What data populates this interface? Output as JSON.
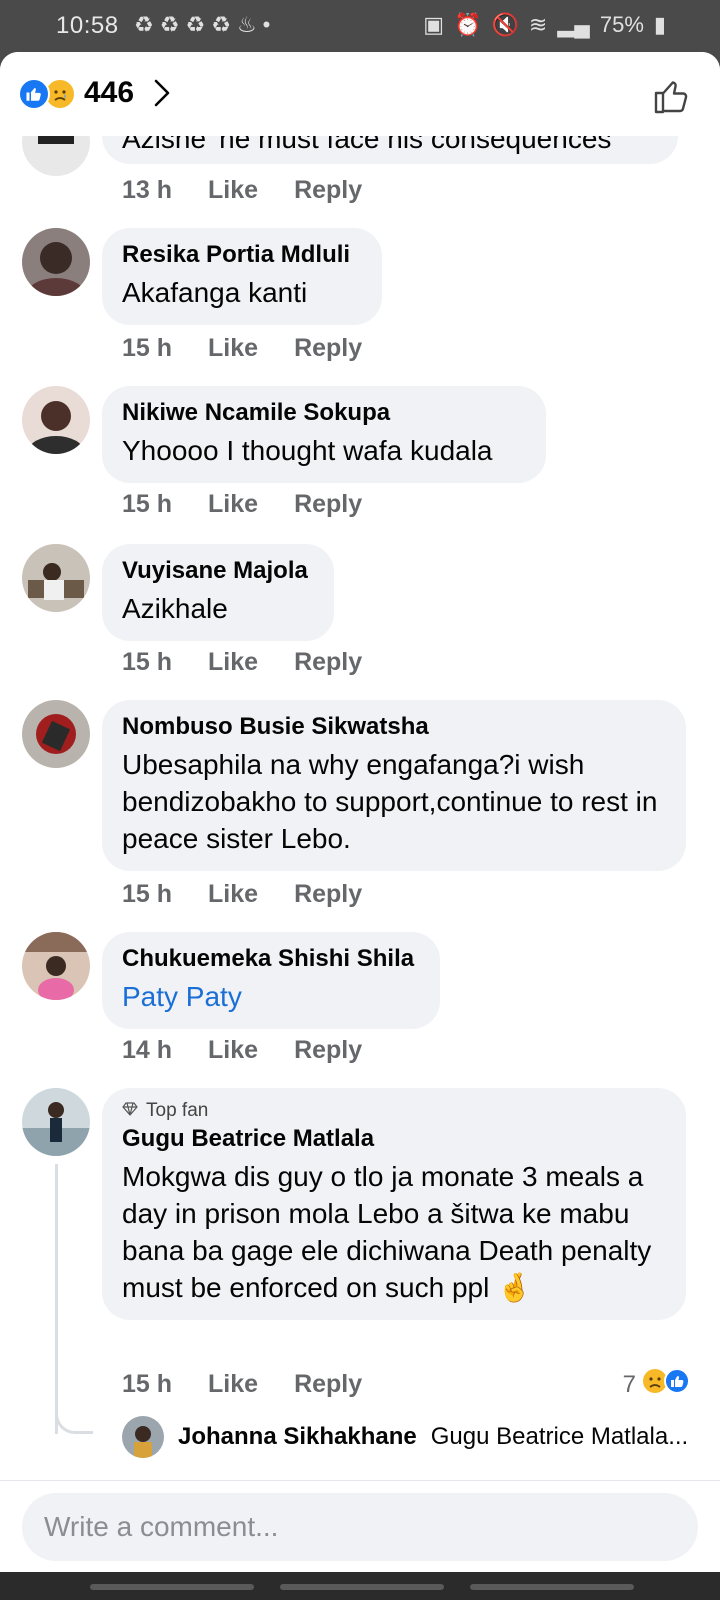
{
  "status_bar": {
    "time": "10:58",
    "battery": "75%"
  },
  "header": {
    "reaction_count": "446"
  },
  "comments": [
    {
      "author": "",
      "text": "Azishe' he must face his  consequences",
      "time": "13 h",
      "like": "Like",
      "reply": "Reply"
    },
    {
      "author": "Resika Portia Mdluli",
      "text": "Akafanga kanti",
      "time": "15 h",
      "like": "Like",
      "reply": "Reply"
    },
    {
      "author": "Nikiwe Ncamile Sokupa",
      "text": "Yhoooo I thought wafa kudala",
      "time": "15 h",
      "like": "Like",
      "reply": "Reply"
    },
    {
      "author": "Vuyisane Majola",
      "text": "Azikhale",
      "time": "15 h",
      "like": "Like",
      "reply": "Reply"
    },
    {
      "author": "Nombuso Busie Sikwatsha",
      "text": "Ubesaphila na why engafanga?i wish bendizobakho to support,continue to rest in peace sister Lebo.",
      "time": "15 h",
      "like": "Like",
      "reply": "Reply"
    },
    {
      "author": "Chukuemeka Shishi Shila",
      "text": "Paty Paty",
      "time": "14 h",
      "like": "Like",
      "reply": "Reply"
    },
    {
      "badge": "Top fan",
      "author": "Gugu Beatrice Matlala",
      "text": "Mokgwa dis guy o tlo ja monate 3 meals a day in prison mola Lebo a šitwa ke mabu bana ba gage ele dichiwana Death penalty must be enforced on such ppl 🤞",
      "time": "15 h",
      "like": "Like",
      "reply": "Reply",
      "reaction_count": "7"
    }
  ],
  "reply_preview": {
    "author": "Johanna Sikhakhane",
    "text": "Gugu Beatrice Matlala..."
  },
  "composer": {
    "placeholder": "Write a comment..."
  },
  "colors": {
    "accent": "#1877f2",
    "link": "#1a6fd6",
    "bubble": "#f0f2f5",
    "meta": "#65676b"
  }
}
